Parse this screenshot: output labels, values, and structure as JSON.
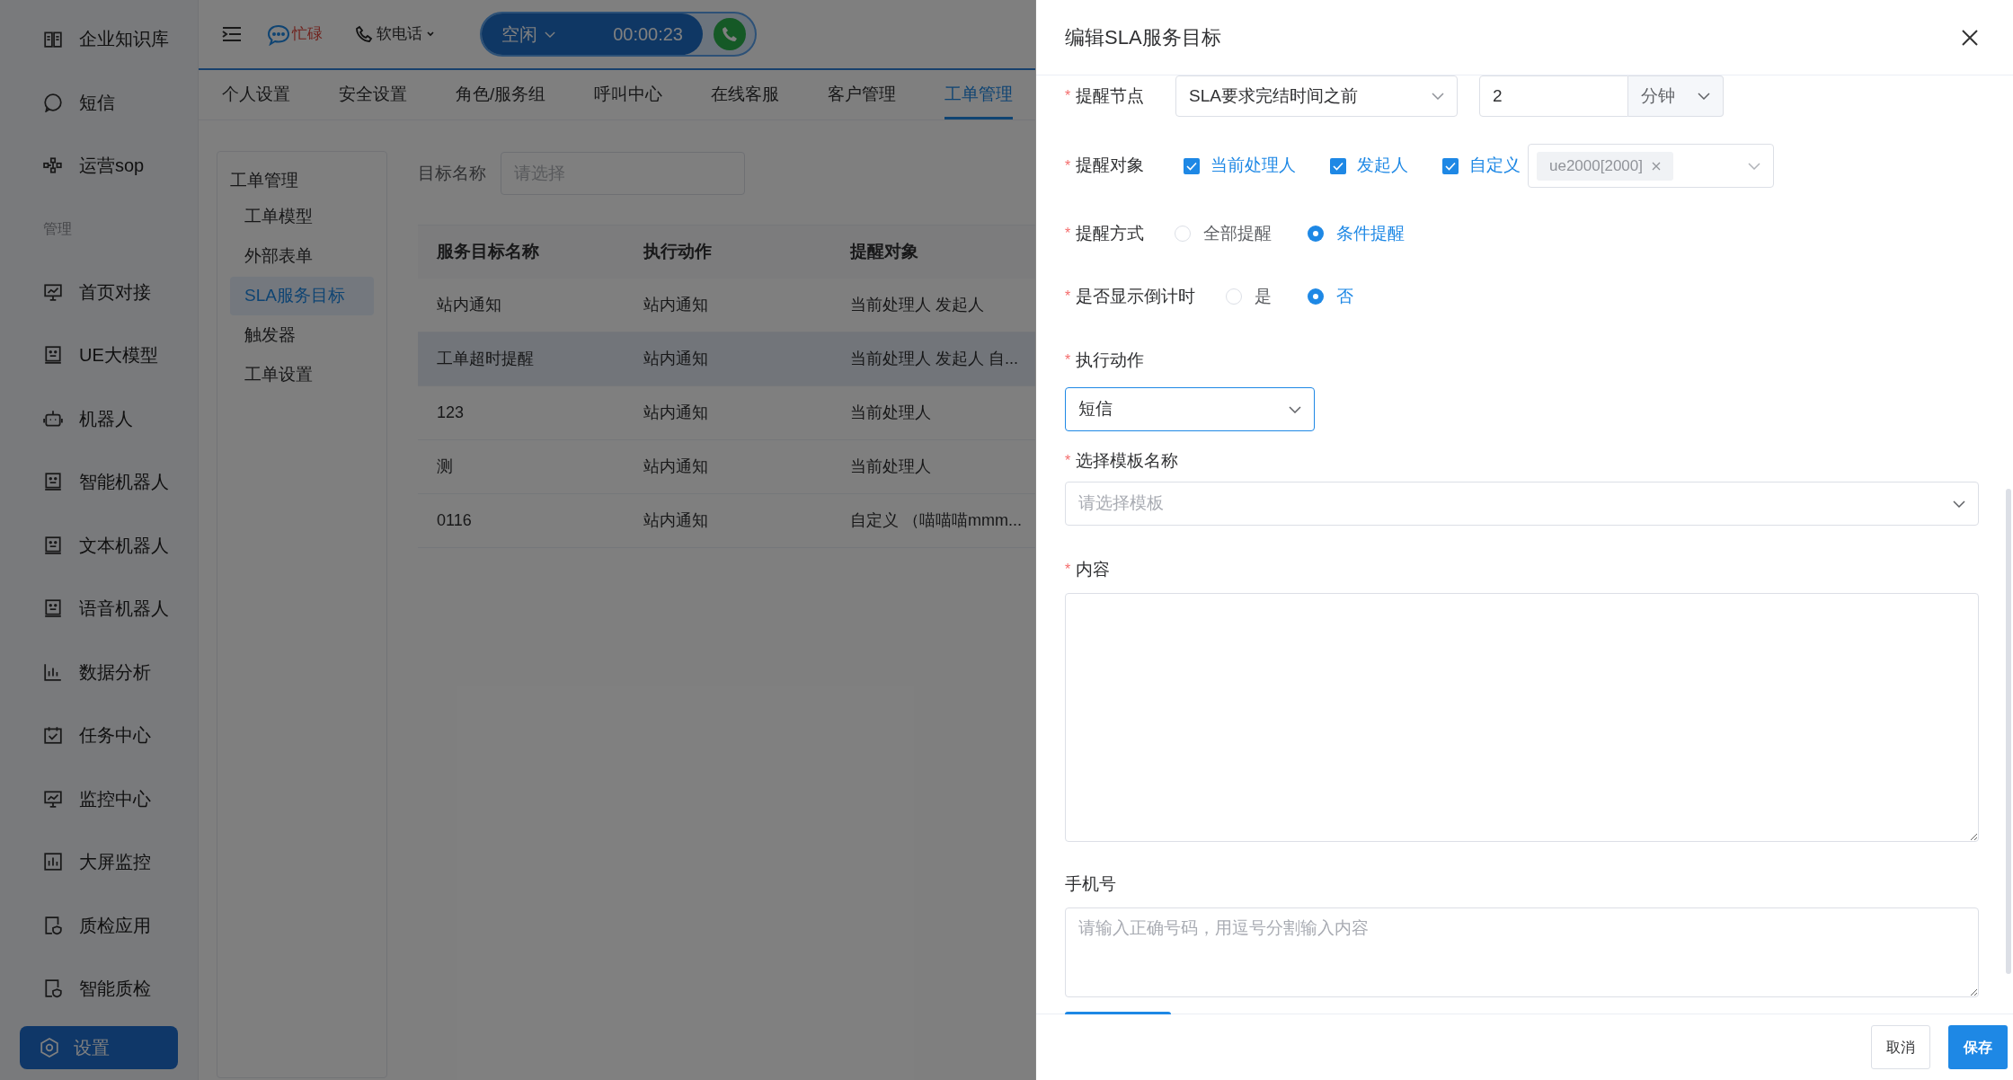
{
  "sidebar": {
    "items": [
      {
        "kind": "item",
        "label": "企业知识库",
        "selected": false
      },
      {
        "kind": "item",
        "label": "短信",
        "selected": false
      },
      {
        "kind": "item",
        "label": "运营sop",
        "selected": false
      },
      {
        "kind": "section",
        "label": "管理"
      },
      {
        "kind": "item",
        "label": "首页对接",
        "selected": false
      },
      {
        "kind": "item",
        "label": "UE大模型",
        "selected": false
      },
      {
        "kind": "item",
        "label": "机器人",
        "selected": false
      },
      {
        "kind": "item",
        "label": "智能机器人",
        "selected": false
      },
      {
        "kind": "item",
        "label": "文本机器人",
        "selected": false
      },
      {
        "kind": "item",
        "label": "语音机器人",
        "selected": false
      },
      {
        "kind": "item",
        "label": "数据分析",
        "selected": false
      },
      {
        "kind": "item",
        "label": "任务中心",
        "selected": false
      },
      {
        "kind": "item",
        "label": "监控中心",
        "selected": false
      },
      {
        "kind": "item",
        "label": "大屏监控",
        "selected": false
      },
      {
        "kind": "item",
        "label": "质检应用",
        "selected": false
      },
      {
        "kind": "item",
        "label": "智能质检",
        "selected": false
      },
      {
        "kind": "item",
        "label": "设置",
        "selected": true
      }
    ]
  },
  "toolbar": {
    "status": "忙碌",
    "phone_menu": "软电话",
    "call_state": "空闲",
    "timer": "00:00:23"
  },
  "tabs": [
    {
      "label": "个人设置",
      "selected": false
    },
    {
      "label": "安全设置",
      "selected": false
    },
    {
      "label": "角色/服务组",
      "selected": false
    },
    {
      "label": "呼叫中心",
      "selected": false
    },
    {
      "label": "在线客服",
      "selected": false
    },
    {
      "label": "客户管理",
      "selected": false
    },
    {
      "label": "工单管理",
      "selected": true
    }
  ],
  "subnav": {
    "title": "工单管理",
    "items": [
      {
        "label": "工单模型",
        "selected": false
      },
      {
        "label": "外部表单",
        "selected": false
      },
      {
        "label": "SLA服务目标",
        "selected": true
      },
      {
        "label": "触发器",
        "selected": false
      },
      {
        "label": "工单设置",
        "selected": false
      }
    ]
  },
  "filter": {
    "label": "目标名称",
    "placeholder": "请选择"
  },
  "table": {
    "columns": [
      "服务目标名称",
      "执行动作",
      "提醒对象"
    ],
    "rows": [
      {
        "cells": [
          "站内通知",
          "站内通知",
          "当前处理人 发起人"
        ],
        "selected": false
      },
      {
        "cells": [
          "工单超时提醒",
          "站内通知",
          "当前处理人 发起人 自..."
        ],
        "selected": true
      },
      {
        "cells": [
          "123",
          "站内通知",
          "当前处理人"
        ],
        "selected": false
      },
      {
        "cells": [
          "测",
          "站内通知",
          "当前处理人"
        ],
        "selected": false
      },
      {
        "cells": [
          "0116",
          "站内通知",
          "自定义 （喵喵喵mmm..."
        ],
        "selected": false
      }
    ]
  },
  "drawer": {
    "title": "编辑SLA服务目标",
    "fields": [
      {
        "kind": "node",
        "mark": "*",
        "label": "提醒节点",
        "value": "SLA要求完结时间之前",
        "number": "2",
        "unit": "分钟"
      },
      {
        "kind": "checkboxes",
        "mark": "*",
        "label": "提醒对象",
        "options": [
          {
            "label": "当前处理人",
            "checked": true
          },
          {
            "label": "发起人",
            "checked": true
          },
          {
            "label": "自定义",
            "checked": true
          }
        ],
        "tags": [
          "ue2000[2000]"
        ]
      },
      {
        "kind": "radios",
        "mark": "*",
        "label": "提醒方式",
        "options": [
          {
            "label": "全部提醒",
            "selected": false
          },
          {
            "label": "条件提醒",
            "selected": true
          }
        ]
      },
      {
        "kind": "radios",
        "mark": "*",
        "label": "是否显示倒计时",
        "options": [
          {
            "label": "是",
            "selected": false
          },
          {
            "label": "否",
            "selected": true
          }
        ]
      },
      {
        "kind": "select",
        "mark": "*",
        "label": "执行动作",
        "value": "短信",
        "focused": true
      },
      {
        "kind": "select",
        "mark": "*",
        "label": "选择模板名称",
        "placeholder": "请选择模板",
        "focused": false
      },
      {
        "kind": "textarea",
        "mark": "*",
        "label": "内容",
        "tall": true
      },
      {
        "kind": "textarea",
        "label": "手机号",
        "placeholder": "请输入正确号码，用逗号分割输入内容",
        "tall": false
      }
    ],
    "buttons": [
      {
        "label": "取消",
        "primary": false
      },
      {
        "label": "保存",
        "primary": true
      }
    ]
  }
}
